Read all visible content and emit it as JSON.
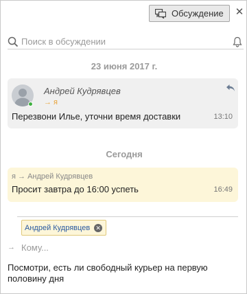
{
  "header": {
    "discussion_button_label": "Обсуждение",
    "discussion_icon": "discussion-icon",
    "close_icon": "close-icon"
  },
  "search": {
    "placeholder": "Поиск в обсуждении",
    "icon": "search-icon",
    "notify_icon": "bell-icon"
  },
  "groups": [
    {
      "date": "23 июня 2017 г."
    },
    {
      "date": "Сегодня"
    }
  ],
  "messages": [
    {
      "author": "Андрей Кудрявцев",
      "recipient": "→ я",
      "text": "Перезвони Илье, уточни время доставки",
      "time": "13:10",
      "avatar_icon": "avatar-icon",
      "reply_icon": "reply-icon"
    },
    {
      "route": "я → Андрей Кудрявцев",
      "text": "Просит завтра до 16:00 успеть",
      "time": "16:49"
    }
  ],
  "compose": {
    "recipient_chip": "Андрей Кудрявцев",
    "to_placeholder": "Кому...",
    "to_arrow": "→",
    "text": "Посмотри, есть ли свободный курьер на первую половину дня"
  },
  "colors": {
    "incoming_bg": "#f0f0f0",
    "outgoing_bg": "#fdf6d9",
    "recipient_accent": "#e8a33a",
    "chip_text": "#2a5aa0",
    "online": "#3fb040"
  }
}
